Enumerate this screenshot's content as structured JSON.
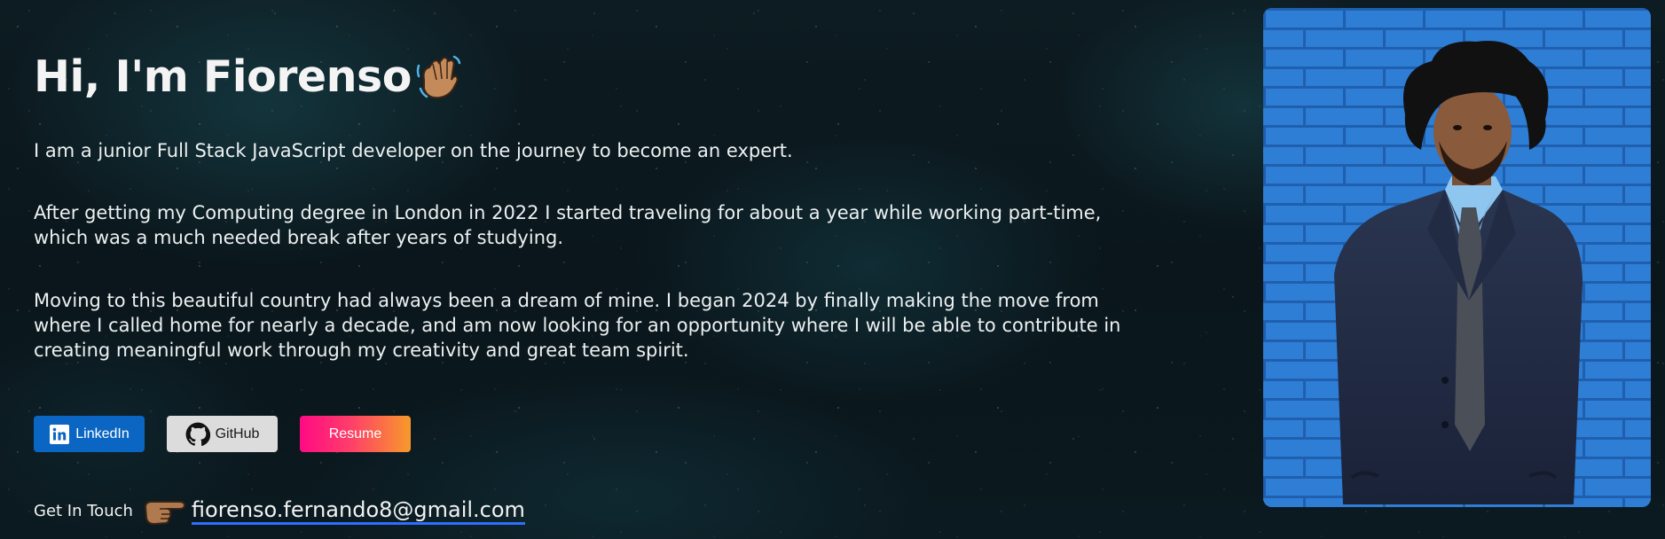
{
  "hero": {
    "title": "Hi, I'm Fiorenso",
    "title_emoji": "waving-hand-icon",
    "paragraphs": [
      "I am a junior Full Stack JavaScript developer on the journey to become an expert.",
      "After getting my Computing degree in London in 2022 I started traveling for about a year while working part-time, which was a much needed break after years of studying.",
      "Moving to this beautiful country had always been a dream of mine. I began 2024 by finally making the move from where I called home for nearly a decade, and am now looking for an opportunity where I will be able to contribute in creating meaningful work through my creativity and great team spirit."
    ]
  },
  "buttons": {
    "linkedin": {
      "label": "LinkedIn",
      "icon": "linkedin-icon",
      "color": "#0a66c2"
    },
    "github": {
      "label": "GitHub",
      "icon": "github-icon",
      "color": "#dcdcdc"
    },
    "resume": {
      "label": "Resume",
      "gradient": [
        "#ff0a84",
        "#f79a2a"
      ]
    }
  },
  "contact": {
    "label": "Get In Touch",
    "pointer_icon": "pointing-hand-icon",
    "email": "fiorenso.fernando8@gmail.com",
    "underline_color": "#2f6fff"
  },
  "portrait": {
    "icon": "profile-photo",
    "wall_color": "#2f7fd6"
  }
}
